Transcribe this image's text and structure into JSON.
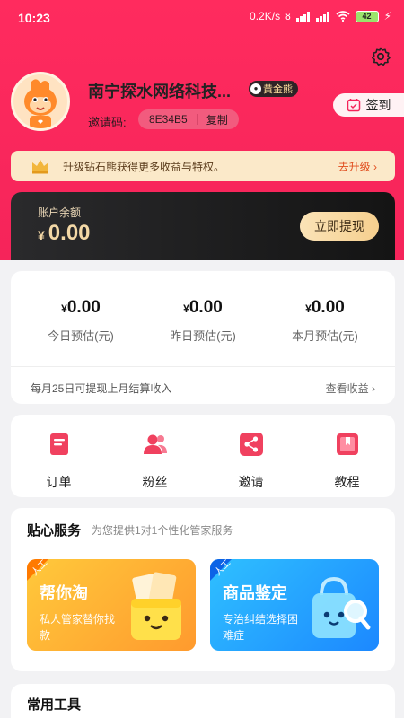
{
  "status_bar": {
    "time": "10:23",
    "network_speed": "0.2K/s",
    "battery": "42"
  },
  "profile": {
    "username": "南宁探水网络科技...",
    "level_badge": "黄金熊",
    "invite_label": "邀请码:",
    "invite_code": "8E34B5",
    "copy_label": "复制",
    "checkin_label": "签到"
  },
  "upgrade": {
    "text": "升级钻石熊获得更多收益与特权。",
    "action": "去升级"
  },
  "balance": {
    "label": "账户余额",
    "currency": "¥",
    "amount": "0.00",
    "withdraw_label": "立即提现"
  },
  "stats": {
    "items": [
      {
        "value": "0.00",
        "label": "今日预估(元)"
      },
      {
        "value": "0.00",
        "label": "昨日预估(元)"
      },
      {
        "value": "0.00",
        "label": "本月预估(元)"
      }
    ],
    "currency": "¥",
    "note": "每月25日可提现上月结算收入",
    "more": "查看收益"
  },
  "menu": {
    "items": [
      {
        "label": "订单",
        "icon": "order-icon"
      },
      {
        "label": "粉丝",
        "icon": "fans-icon"
      },
      {
        "label": "邀请",
        "icon": "share-icon"
      },
      {
        "label": "教程",
        "icon": "tutorial-icon"
      }
    ]
  },
  "service": {
    "title": "贴心服务",
    "subtitle": "为您提供1对1个性化管家服务",
    "cards": [
      {
        "tag": "人工",
        "title": "帮你淘",
        "desc": "私人管家替你找款"
      },
      {
        "tag": "人工",
        "title": "商品鉴定",
        "desc": "专治纠结选择困难症"
      }
    ]
  },
  "tools": {
    "title": "常用工具"
  },
  "colors": {
    "brand": "#f5245a",
    "gold": "#f3d8a6",
    "menu_icon": "#f0415f"
  }
}
